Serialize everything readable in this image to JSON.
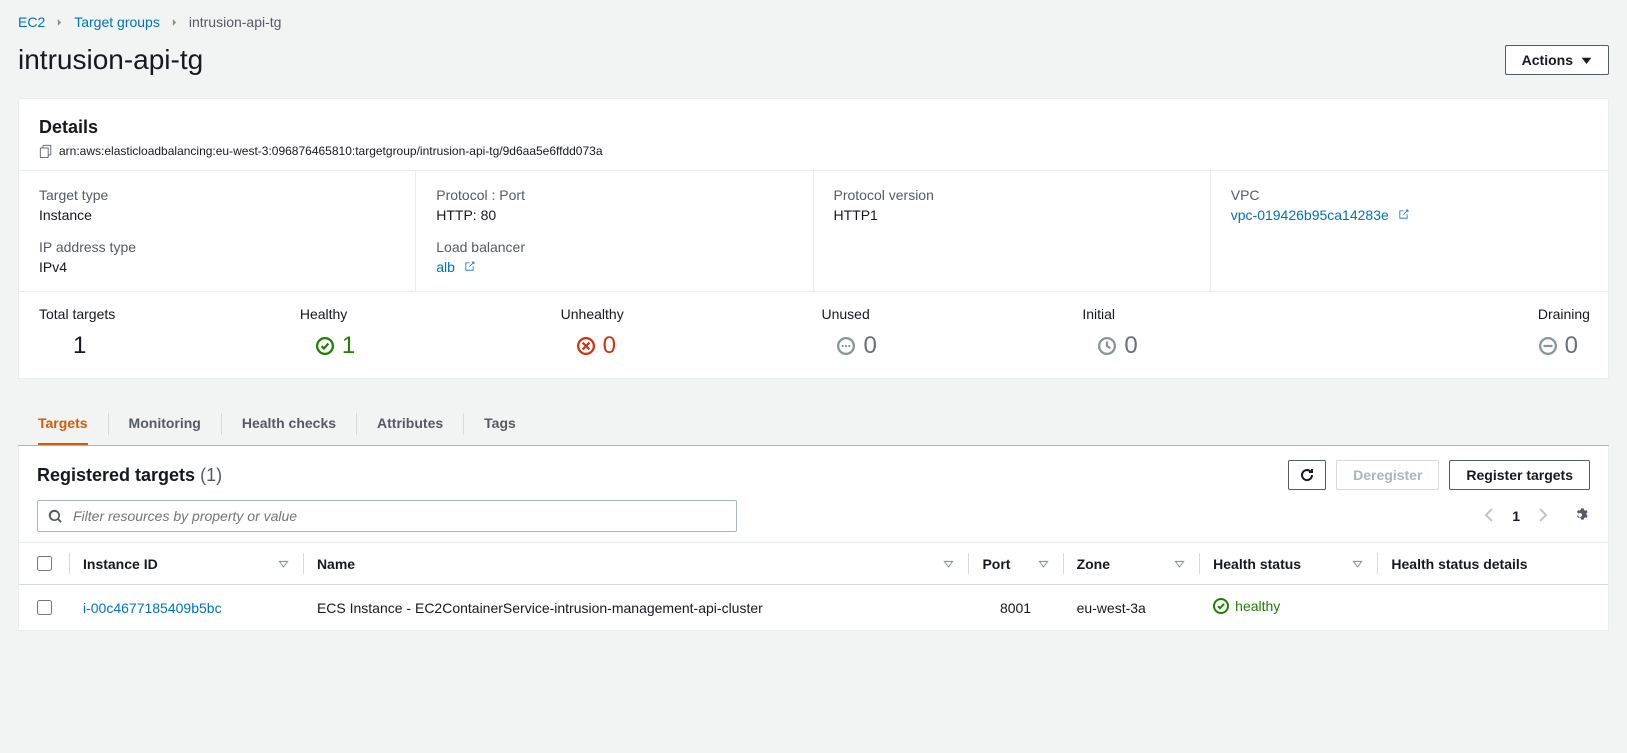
{
  "breadcrumb": {
    "root": "EC2",
    "parent": "Target groups",
    "current": "intrusion-api-tg"
  },
  "header": {
    "title": "intrusion-api-tg",
    "actions_label": "Actions"
  },
  "details": {
    "section_title": "Details",
    "arn": "arn:aws:elasticloadbalancing:eu-west-3:096876465810:targetgroup/intrusion-api-tg/9d6aa5e6ffdd073a",
    "target_type_label": "Target type",
    "target_type_value": "Instance",
    "protocol_port_label": "Protocol : Port",
    "protocol_port_value": "HTTP: 80",
    "protocol_version_label": "Protocol version",
    "protocol_version_value": "HTTP1",
    "vpc_label": "VPC",
    "vpc_value": "vpc-019426b95ca14283e",
    "ip_type_label": "IP address type",
    "ip_type_value": "IPv4",
    "lb_label": "Load balancer",
    "lb_value": "alb"
  },
  "stats": {
    "total_label": "Total targets",
    "total_value": "1",
    "healthy_label": "Healthy",
    "healthy_value": "1",
    "unhealthy_label": "Unhealthy",
    "unhealthy_value": "0",
    "unused_label": "Unused",
    "unused_value": "0",
    "initial_label": "Initial",
    "initial_value": "0",
    "draining_label": "Draining",
    "draining_value": "0"
  },
  "tabs": {
    "targets": "Targets",
    "monitoring": "Monitoring",
    "health_checks": "Health checks",
    "attributes": "Attributes",
    "tags": "Tags"
  },
  "registered": {
    "title": "Registered targets",
    "count": "(1)",
    "deregister_label": "Deregister",
    "register_label": "Register targets",
    "filter_placeholder": "Filter resources by property or value",
    "page": "1",
    "columns": {
      "instance_id": "Instance ID",
      "name": "Name",
      "port": "Port",
      "zone": "Zone",
      "health_status": "Health status",
      "health_status_details": "Health status details"
    },
    "rows": [
      {
        "instance_id": "i-00c4677185409b5bc",
        "name": "ECS Instance - EC2ContainerService-intrusion-management-api-cluster",
        "port": "8001",
        "zone": "eu-west-3a",
        "health_status": "healthy",
        "health_status_details": ""
      }
    ]
  }
}
